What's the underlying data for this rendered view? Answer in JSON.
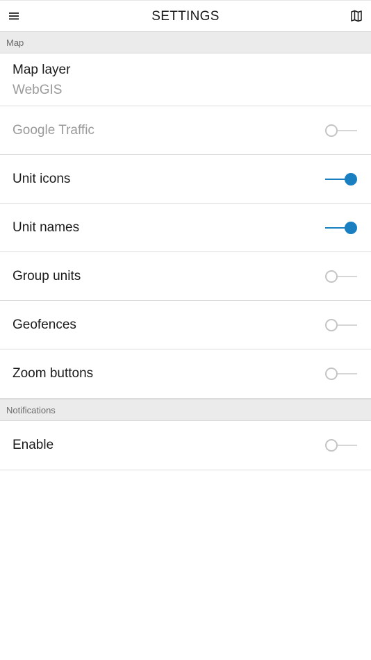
{
  "header": {
    "title": "SETTINGS",
    "menu_icon": "hamburger-menu-icon",
    "map_icon": "folded-map-icon"
  },
  "colors": {
    "accent": "#1a7fc1",
    "section_bg": "#ebebeb",
    "disabled_text": "#9a9a9a"
  },
  "sections": {
    "map": {
      "label": "Map",
      "items": [
        {
          "label": "Map layer",
          "value": "WebGIS"
        },
        {
          "label": "Google Traffic",
          "enabled": false,
          "disabled": true
        },
        {
          "label": "Unit icons",
          "enabled": true
        },
        {
          "label": "Unit names",
          "enabled": true
        },
        {
          "label": "Group units",
          "enabled": false
        },
        {
          "label": "Geofences",
          "enabled": false
        },
        {
          "label": "Zoom buttons",
          "enabled": false
        }
      ]
    },
    "notifications": {
      "label": "Notifications",
      "items": [
        {
          "label": "Enable",
          "enabled": false
        }
      ]
    }
  }
}
